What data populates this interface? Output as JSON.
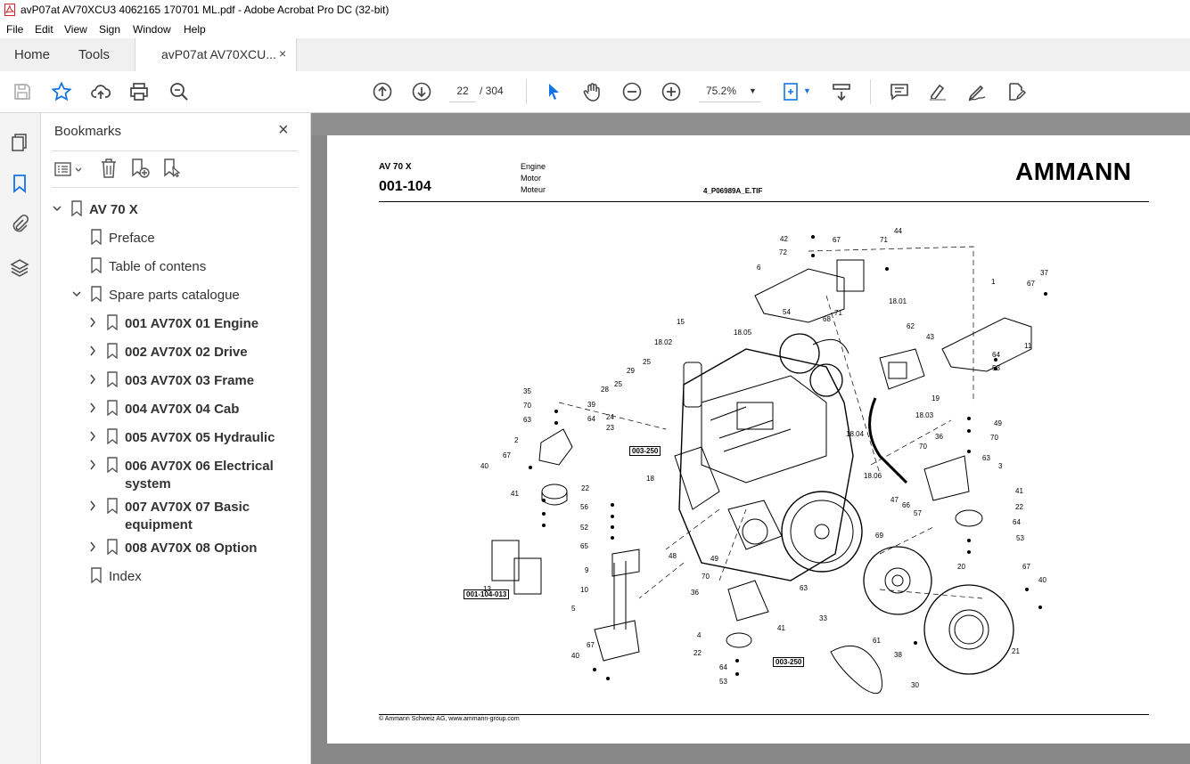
{
  "window": {
    "title": "avP07at AV70XCU3 4062165 170701 ML.pdf - Adobe Acrobat Pro DC (32-bit)"
  },
  "menu": [
    "File",
    "Edit",
    "View",
    "Sign",
    "Window",
    "Help"
  ],
  "tabs": {
    "home": "Home",
    "tools": "Tools",
    "document": "avP07at AV70XCU...",
    "close": "×"
  },
  "toolbar": {
    "page_current": "22",
    "page_total": "/ 304",
    "zoom": "75.2%"
  },
  "bookmarks": {
    "title": "Bookmarks",
    "close": "×",
    "items": [
      {
        "label": "AV 70 X",
        "level": 0,
        "expand": "down",
        "bold": true
      },
      {
        "label": "Preface",
        "level": 1,
        "expand": "none",
        "bold": false
      },
      {
        "label": "Table of contens",
        "level": 1,
        "expand": "none",
        "bold": false
      },
      {
        "label": "Spare parts catalogue",
        "level": 1,
        "expand": "down",
        "bold": false
      },
      {
        "label": "001 AV70X 01 Engine",
        "level": 2,
        "expand": "right",
        "bold": true
      },
      {
        "label": "002 AV70X 02 Drive",
        "level": 2,
        "expand": "right",
        "bold": true
      },
      {
        "label": "003 AV70X 03 Frame",
        "level": 2,
        "expand": "right",
        "bold": true
      },
      {
        "label": "004 AV70X 04 Cab",
        "level": 2,
        "expand": "right",
        "bold": true
      },
      {
        "label": "005 AV70X 05 Hydraulic",
        "level": 2,
        "expand": "right",
        "bold": true
      },
      {
        "label": "006 AV70X 06 Electrical",
        "label2": "system",
        "level": 2,
        "expand": "right",
        "bold": true
      },
      {
        "label": "007 AV70X 07 Basic",
        "label2": "equipment",
        "level": 2,
        "expand": "right",
        "bold": true
      },
      {
        "label": "008 AV70X 08 Option",
        "level": 2,
        "expand": "right",
        "bold": true
      },
      {
        "label": "Index",
        "level": 1,
        "expand": "none",
        "bold": false
      }
    ]
  },
  "document": {
    "model": "AV 70 X",
    "code": "001-104",
    "desc_en": "Engine",
    "desc_de": "Motor",
    "desc_fr": "Moteur",
    "image_file": "4_P06989A_E.TIF",
    "brand": "AMMANN",
    "footer": "© Ammann Schweiz AG, www.ammann-group.com",
    "ref_boxes": [
      "003-250",
      "001-104-013",
      "003-250"
    ],
    "part_labels": [
      "42",
      "67",
      "72",
      "44",
      "71",
      "6",
      "18.01",
      "54",
      "68",
      "71",
      "1",
      "37",
      "67",
      "11",
      "62",
      "43",
      "64",
      "53",
      "15",
      "18.05",
      "18.02",
      "25",
      "29",
      "28",
      "25",
      "35",
      "39",
      "70",
      "63",
      "64",
      "24",
      "23",
      "003-250",
      "2",
      "67",
      "40",
      "41",
      "22",
      "19",
      "18.03",
      "18.04",
      "70",
      "36",
      "63",
      "49",
      "70",
      "3",
      "18",
      "18.06",
      "47",
      "66",
      "57",
      "41",
      "22",
      "64",
      "53",
      "56",
      "52",
      "65",
      "48",
      "69",
      "9",
      "10",
      "5",
      "13",
      "49",
      "70",
      "36",
      "63",
      "20",
      "67",
      "40",
      "4",
      "41",
      "22",
      "64",
      "53",
      "67",
      "40",
      "33",
      "61",
      "38",
      "30",
      "21"
    ]
  },
  "colors": {
    "accent": "#1473e6",
    "titlebar_icon": "#d4202a"
  }
}
